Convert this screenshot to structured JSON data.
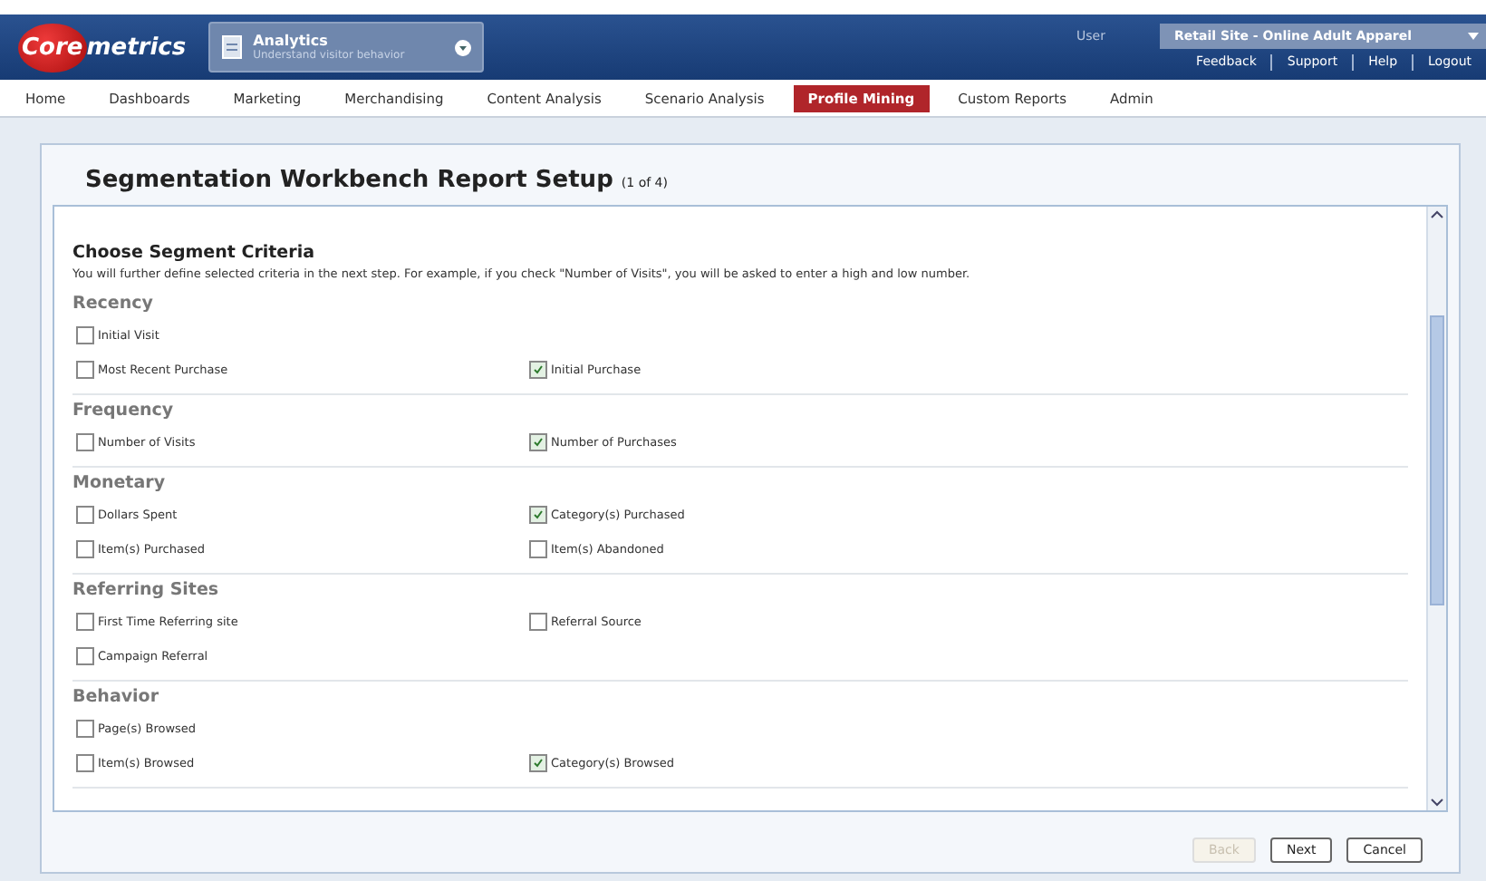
{
  "header": {
    "logo": {
      "first": "Core",
      "second": "metrics"
    },
    "app_switcher": {
      "title": "Analytics",
      "subtitle": "Understand visitor behavior"
    },
    "user": "User",
    "site_selector": "Retail Site - Online Adult Apparel",
    "links": [
      "Feedback",
      "Support",
      "Help",
      "Logout"
    ]
  },
  "nav": [
    {
      "label": "Home",
      "selected": false
    },
    {
      "label": "Dashboards",
      "selected": false
    },
    {
      "label": "Marketing",
      "selected": false
    },
    {
      "label": "Merchandising",
      "selected": false
    },
    {
      "label": "Content Analysis",
      "selected": false
    },
    {
      "label": "Scenario Analysis",
      "selected": false
    },
    {
      "label": "Profile Mining",
      "selected": true
    },
    {
      "label": "Custom Reports",
      "selected": false
    },
    {
      "label": "Admin",
      "selected": false
    }
  ],
  "panel": {
    "title": "Segmentation Workbench Report Setup",
    "step": "(1 of 4)",
    "heading": "Choose Segment Criteria",
    "description": "You will further define selected criteria in the next step. For example, if you check \"Number of Visits\", you will be asked to enter a high and low number.",
    "sections": [
      {
        "name": "Recency",
        "rows": [
          [
            {
              "label": "Initial Visit",
              "checked": false
            }
          ],
          [
            {
              "label": "Most Recent Purchase",
              "checked": false
            },
            {
              "label": "Initial Purchase",
              "checked": true
            }
          ]
        ]
      },
      {
        "name": "Frequency",
        "rows": [
          [
            {
              "label": "Number of Visits",
              "checked": false
            },
            {
              "label": "Number of Purchases",
              "checked": true
            }
          ]
        ]
      },
      {
        "name": "Monetary",
        "rows": [
          [
            {
              "label": "Dollars Spent",
              "checked": false
            },
            {
              "label": "Category(s) Purchased",
              "checked": true
            }
          ],
          [
            {
              "label": "Item(s) Purchased",
              "checked": false
            },
            {
              "label": "Item(s) Abandoned",
              "checked": false
            }
          ]
        ]
      },
      {
        "name": "Referring Sites",
        "rows": [
          [
            {
              "label": "First Time Referring site",
              "checked": false
            },
            {
              "label": "Referral Source",
              "checked": false
            }
          ],
          [
            {
              "label": "Campaign Referral",
              "checked": false
            }
          ]
        ]
      },
      {
        "name": "Behavior",
        "rows": [
          [
            {
              "label": "Page(s) Browsed",
              "checked": false
            }
          ],
          [
            {
              "label": "Item(s) Browsed",
              "checked": false
            },
            {
              "label": "Category(s) Browsed",
              "checked": true
            }
          ]
        ]
      }
    ],
    "buttons": [
      {
        "label": "Back",
        "disabled": true
      },
      {
        "label": "Next",
        "disabled": false
      },
      {
        "label": "Cancel",
        "disabled": false
      }
    ]
  }
}
